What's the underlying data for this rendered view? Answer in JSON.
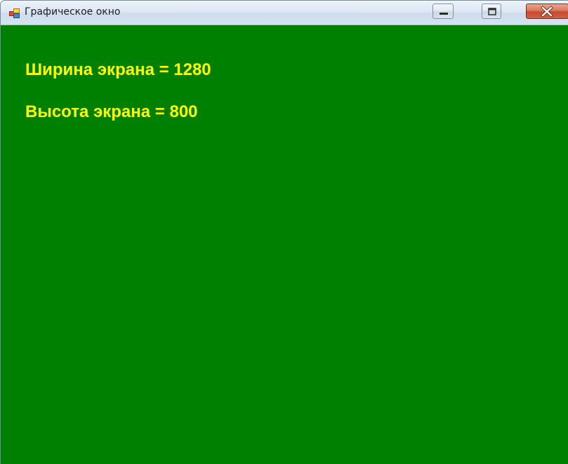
{
  "window": {
    "title": "Графическое окно",
    "client_background": "#008000",
    "text_color": "#FFFF00"
  },
  "caption_buttons": {
    "minimize_icon": "minimize-icon",
    "maximize_icon": "maximize-icon",
    "close_icon": "close-icon"
  },
  "content": {
    "lines": [
      "Ширина экрана = 1280",
      "Высота экрана = 800"
    ]
  }
}
